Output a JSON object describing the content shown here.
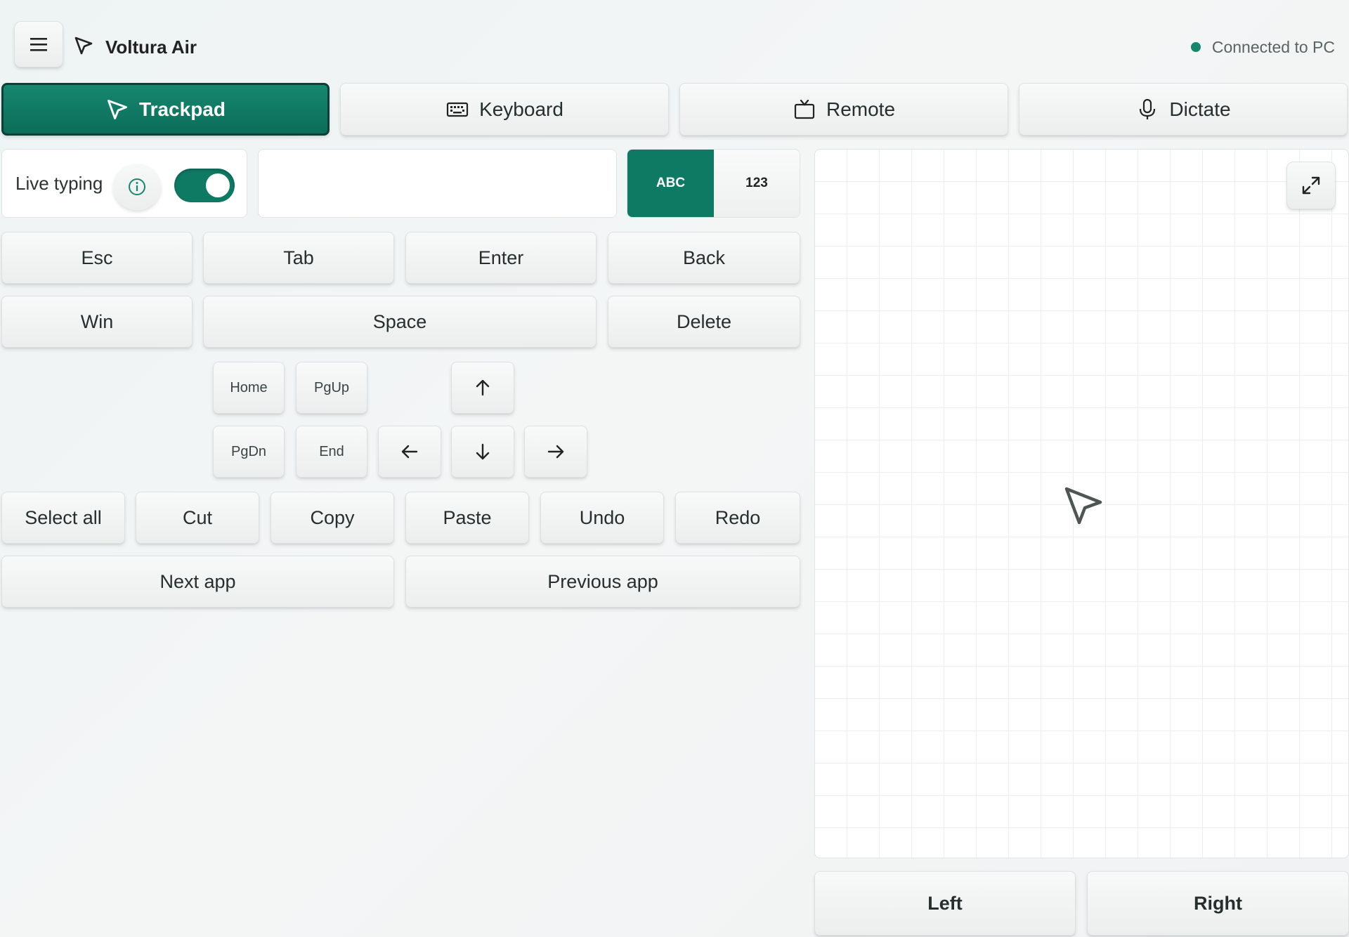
{
  "app": {
    "title": "Voltura Air",
    "status": "Connected to PC",
    "status_color": "#16876f",
    "icons": {
      "menu": "hamburger-menu-icon",
      "logo": "cursor-arrow-icon"
    }
  },
  "tabs": [
    {
      "label": "Trackpad",
      "icon": "cursor-arrow-icon",
      "active": true
    },
    {
      "label": "Keyboard",
      "icon": "keyboard-icon",
      "active": false
    },
    {
      "label": "Remote",
      "icon": "tv-icon",
      "active": false
    },
    {
      "label": "Dictate",
      "icon": "microphone-icon",
      "active": false
    }
  ],
  "live_typing": {
    "label": "Live typing",
    "enabled": true,
    "input_value": "",
    "mode_abc": "ABC",
    "mode_123": "123",
    "selected_mode": "ABC"
  },
  "keys": {
    "row1": [
      "Esc",
      "Tab",
      "Enter",
      "Back"
    ],
    "row2": [
      "Win",
      "Space",
      "Delete"
    ],
    "nav": [
      "Home",
      "PgUp",
      "PgDn",
      "End"
    ],
    "arrows": [
      "arrow-up-icon",
      "arrow-left-icon",
      "arrow-down-icon",
      "arrow-right-icon"
    ],
    "edit": [
      "Select all",
      "Cut",
      "Copy",
      "Paste",
      "Undo",
      "Redo"
    ],
    "apps": [
      "Next app",
      "Previous app"
    ]
  },
  "trackpad": {
    "expand_icon": "expand-icon",
    "cursor_icon": "cursor-arrow-icon",
    "left_label": "Left",
    "right_label": "Right"
  },
  "colors": {
    "accent": "#0f7a64",
    "accent_dark": "#0d3f36",
    "background": "#f1f4f4"
  }
}
